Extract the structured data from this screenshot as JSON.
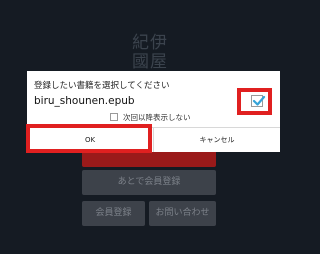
{
  "logo": {
    "line1": "紀伊",
    "line2": "國屋"
  },
  "background_buttons": {
    "later_register": "あとで会員登録",
    "register": "会員登録",
    "contact": "お問い合わせ"
  },
  "dialog": {
    "message": "登録したい書籍を選択してください",
    "filename": "biru_shounen.epub",
    "file_checked": true,
    "dont_show_again": "次回以降表示しない",
    "ok_label": "OK",
    "cancel_label": "キャンセル"
  },
  "colors": {
    "highlight": "#e02020",
    "check_accent": "#35a3d8",
    "background": "#151b23"
  }
}
